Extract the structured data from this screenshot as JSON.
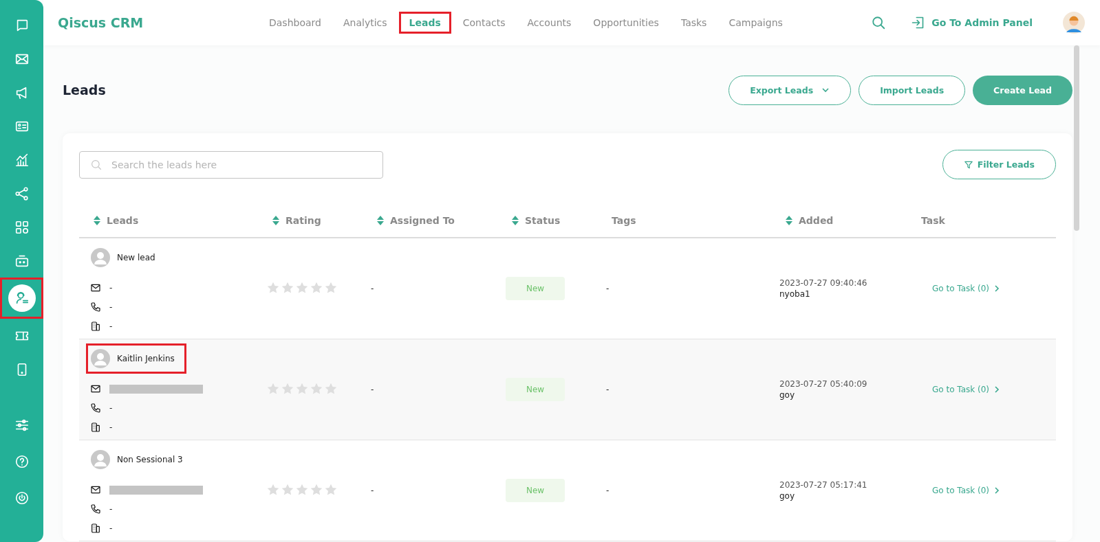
{
  "sidebar": {
    "items": [
      {
        "selected": false,
        "highlighted": false
      },
      {
        "selected": false,
        "highlighted": false
      },
      {
        "selected": false,
        "highlighted": false
      },
      {
        "selected": false,
        "highlighted": false
      },
      {
        "selected": false,
        "highlighted": false
      },
      {
        "selected": false,
        "highlighted": false
      },
      {
        "selected": false,
        "highlighted": false
      },
      {
        "selected": false,
        "highlighted": false
      },
      {
        "selected": true,
        "highlighted": true
      },
      {
        "selected": false,
        "highlighted": false
      },
      {
        "selected": false,
        "highlighted": false
      }
    ]
  },
  "topbar": {
    "brand": "Qiscus CRM",
    "nav": [
      {
        "label": "Dashboard",
        "selected": false,
        "highlighted": false
      },
      {
        "label": "Analytics",
        "selected": false,
        "highlighted": false
      },
      {
        "label": "Leads",
        "selected": true,
        "highlighted": true
      },
      {
        "label": "Contacts",
        "selected": false,
        "highlighted": false
      },
      {
        "label": "Accounts",
        "selected": false,
        "highlighted": false
      },
      {
        "label": "Opportunities",
        "selected": false,
        "highlighted": false
      },
      {
        "label": "Tasks",
        "selected": false,
        "highlighted": false
      },
      {
        "label": "Campaigns",
        "selected": false,
        "highlighted": false
      }
    ],
    "admin_link": "Go To Admin Panel"
  },
  "page": {
    "title": "Leads",
    "actions": [
      {
        "label": "Export Leads",
        "kind": "dropdown"
      },
      {
        "label": "Import Leads",
        "kind": "outline"
      },
      {
        "label": "Create Lead",
        "kind": "primary"
      }
    ]
  },
  "search": {
    "placeholder": "Search the leads here"
  },
  "filter_button": "Filter Leads",
  "table": {
    "columns": [
      {
        "label": "Leads",
        "sortable": true
      },
      {
        "label": "Rating",
        "sortable": true
      },
      {
        "label": "Assigned To",
        "sortable": true
      },
      {
        "label": "Status",
        "sortable": true
      },
      {
        "label": "Tags",
        "sortable": false
      },
      {
        "label": "Added",
        "sortable": true
      },
      {
        "label": "Task",
        "sortable": false
      }
    ],
    "rows": [
      {
        "name": "New lead",
        "highlighted": false,
        "hovered": false,
        "email": "-",
        "email_redacted": false,
        "phone": "-",
        "company": "-",
        "stars": 0,
        "assigned_to": "-",
        "status": "New",
        "tags": "-",
        "added": "2023-07-27 09:40:46",
        "added_by": "nyoba1",
        "task": "Go to Task (0)"
      },
      {
        "name": "Kaitlin Jenkins",
        "highlighted": true,
        "hovered": true,
        "email_redacted": true,
        "phone": "-",
        "company": "-",
        "stars": 0,
        "assigned_to": "-",
        "status": "New",
        "tags": "-",
        "added": "2023-07-27 05:40:09",
        "added_by": "goy",
        "task": "Go to Task (0)"
      },
      {
        "name": "Non Sessional 3",
        "highlighted": false,
        "hovered": false,
        "email_redacted": true,
        "phone": "-",
        "company": "-",
        "stars": 0,
        "assigned_to": "-",
        "status": "New",
        "tags": "-",
        "added": "2023-07-27 05:17:41",
        "added_by": "goy",
        "task": "Go to Task (0)"
      }
    ]
  }
}
